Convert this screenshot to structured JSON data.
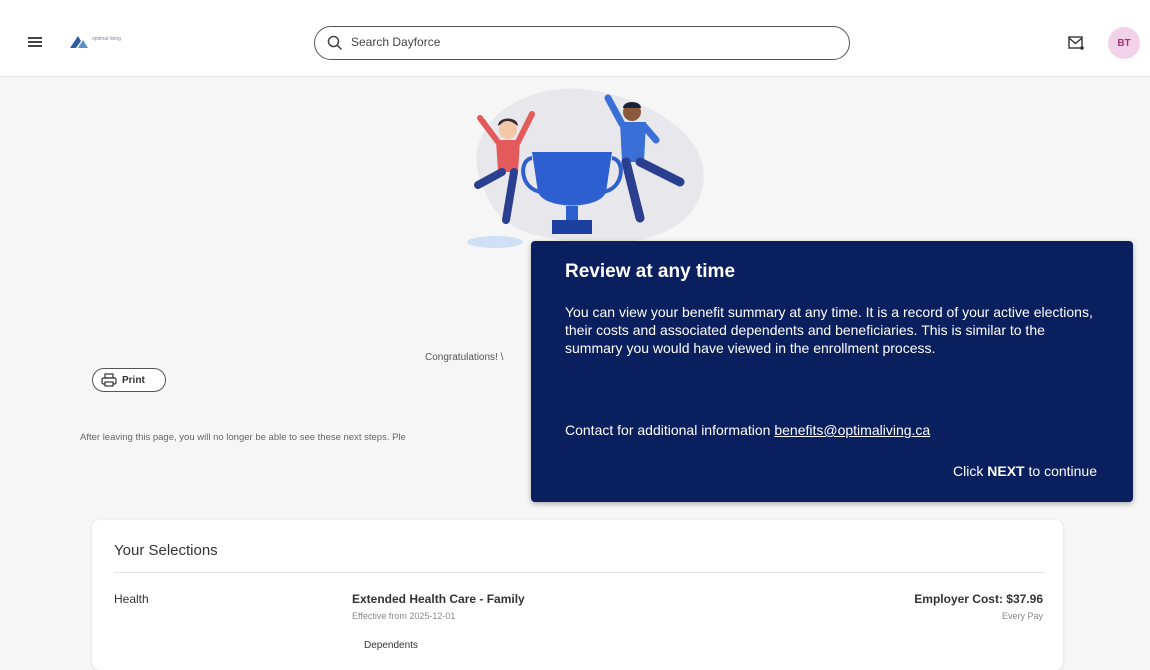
{
  "header": {
    "logo_text": "optimal living",
    "search_placeholder": "Search Dayforce",
    "avatar_initials": "BT"
  },
  "content": {
    "congrats_text": "Congratulations! \\",
    "print_label": "Print",
    "after_text": "After leaving this page, you will no longer be able to see these next steps. Ple"
  },
  "selections": {
    "title": "Your Selections",
    "rows": [
      {
        "category": "Health",
        "plan": "Extended Health Care - Family",
        "effective": "Effective from 2025-12-01",
        "dependents_label": "Dependents",
        "cost": "Employer Cost: $37.96",
        "frequency": "Every Pay"
      }
    ]
  },
  "tooltip": {
    "title": "Review at any time",
    "body": "You can view your benefit summary at any time. It is a record of your active elections, their costs and associated dependents and beneficiaries. This is similar to the summary you would have viewed in the enrollment process.",
    "contact_prefix": "Contact for additional information",
    "contact_email": "benefits@optimaliving.ca",
    "next_prefix": "Click",
    "next_bold": "NEXT",
    "next_suffix": "to continue"
  },
  "colors": {
    "tooltip_bg": "#0a1f5e",
    "avatar_bg": "#f2d2e8",
    "trophy": "#2e5fd0"
  }
}
